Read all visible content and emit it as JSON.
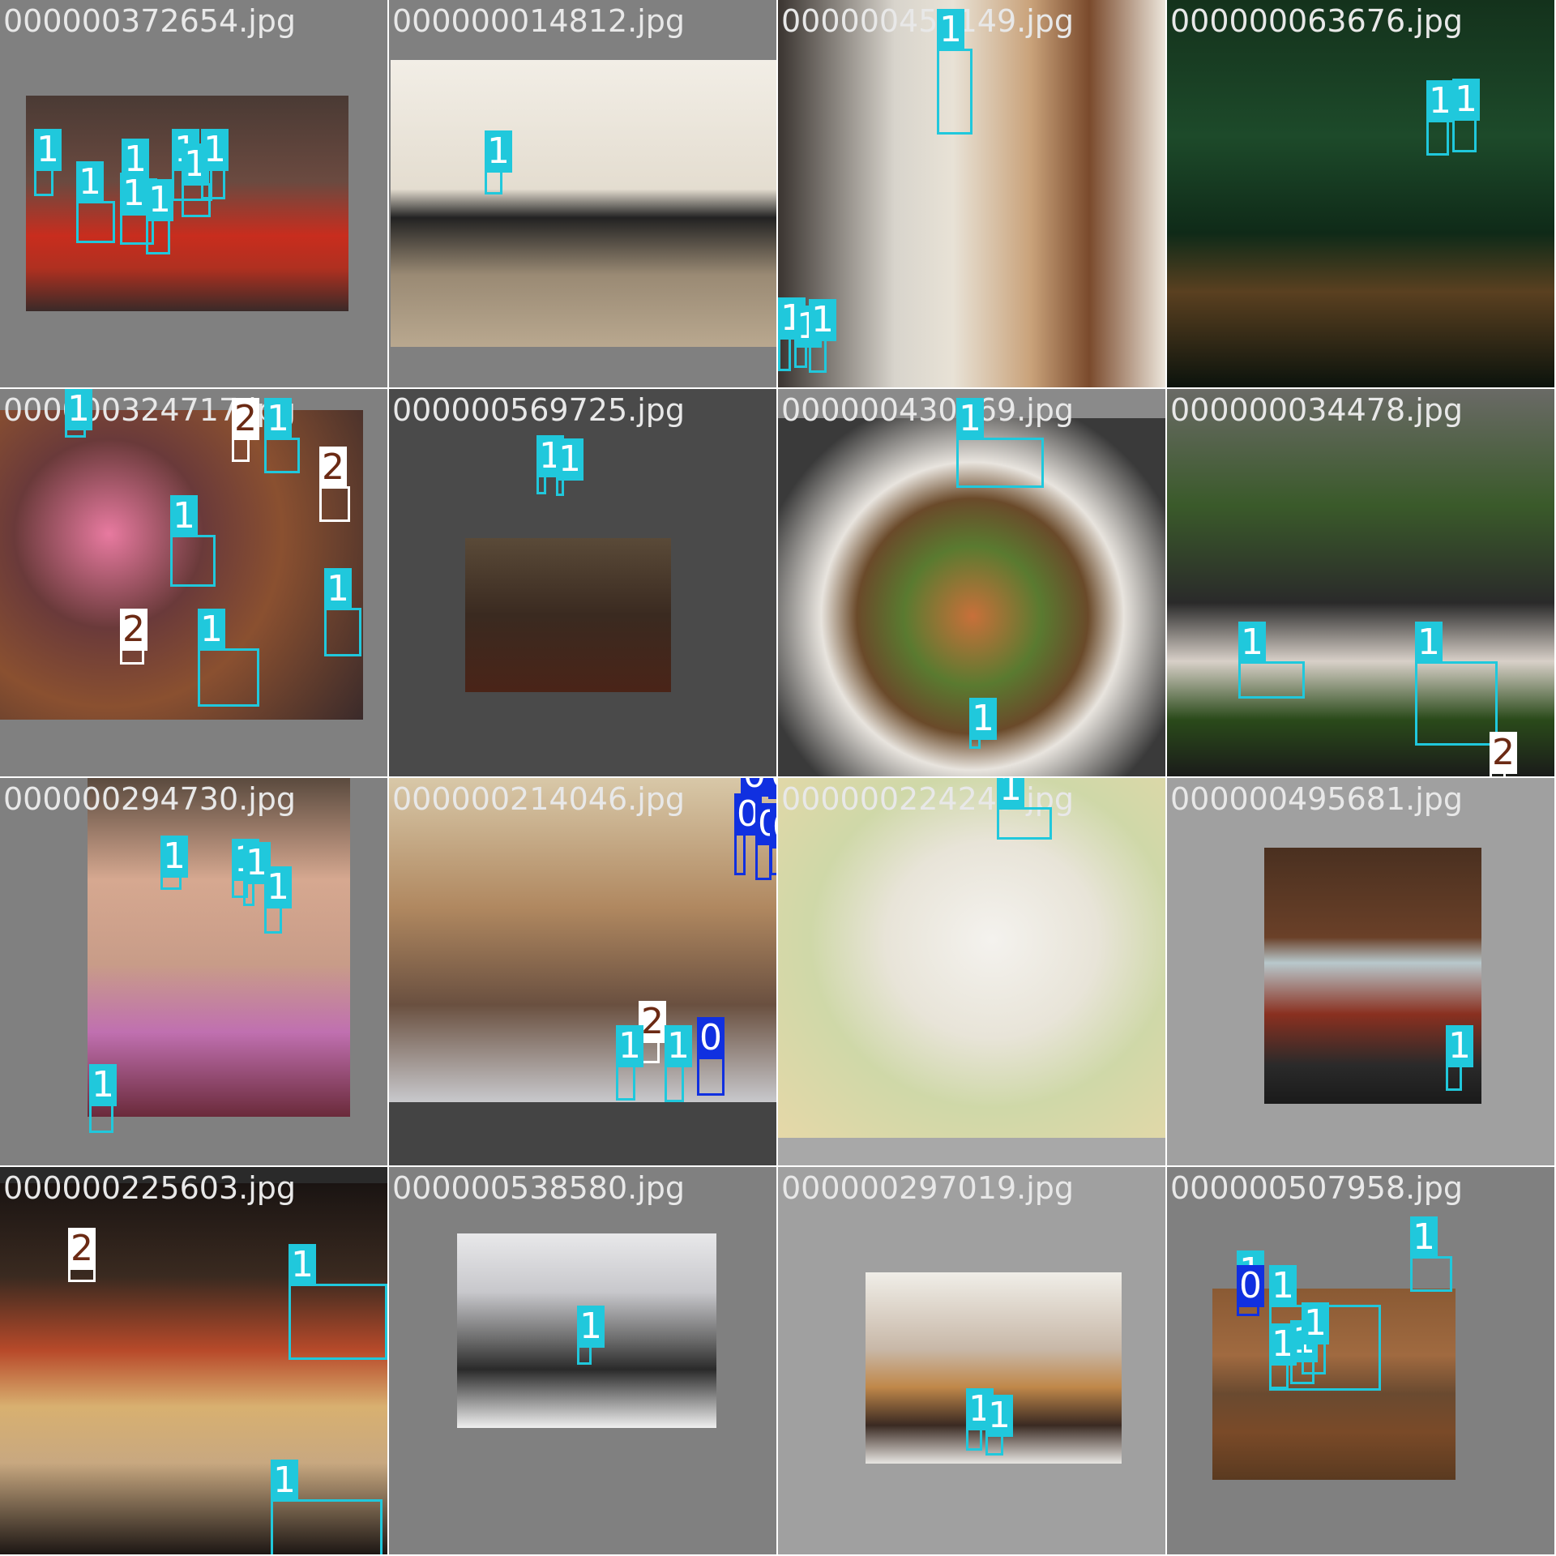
{
  "label_colors": {
    "0": "#1030e0",
    "1": "#20c8dc",
    "2": "#ffffff"
  },
  "tiles": [
    {
      "filename": "000000372654.jpg",
      "bg": "#808080",
      "photo_bg": "linear-gradient(180deg,#4a3a34 0%,#6b4a40 40%,#c82d1e 65%,#b03020 80%,#3a2a28 100%)",
      "boxes": [
        [
          "1"
        ],
        [
          "1"
        ],
        [
          "1"
        ],
        [
          "1"
        ],
        [
          "1"
        ],
        [
          "1"
        ],
        [
          "1"
        ],
        [
          "1"
        ]
      ]
    },
    {
      "filename": "000000014812.jpg",
      "bg": "#808080",
      "photo_bg": "linear-gradient(180deg,#f2eee6 0%,#e4ddd0 45%,#222 55%,#9a8a74 75%,#b9a88f 100%)",
      "boxes": [
        [
          "1"
        ]
      ]
    },
    {
      "filename": "000000455149.jpg",
      "bg": "#6a5a4a",
      "photo_bg": "linear-gradient(90deg,#3a3430 0%,#d8d4cc 30%,#e8e2d6 45%,#c9a27a 65%,#7a4a2c 80%,#efe9df 100%)",
      "boxes": [
        [
          "1"
        ],
        [
          "1"
        ],
        [
          "1"
        ],
        [
          "1"
        ]
      ]
    },
    {
      "filename": "000000063676.jpg",
      "bg": "#101a12",
      "photo_bg": "linear-gradient(180deg,#14321c 0%,#1d4a2a 35%,#0f2a18 60%,#5a4020 75%,#0a120c 100%)",
      "boxes": [
        [
          "1"
        ],
        [
          "1"
        ]
      ]
    },
    {
      "filename": "000000324717.jpg",
      "bg": "#808080",
      "photo_bg": "radial-gradient(circle at 30% 40%,#e87aa0 0%,#6a3a3a 30%,#8a5030 55%,#3a2a2a 100%)",
      "boxes": [
        [
          "1"
        ],
        [
          "2"
        ],
        [
          "1"
        ],
        [
          "2"
        ],
        [
          "1"
        ],
        [
          "1"
        ],
        [
          "1"
        ],
        [
          "2"
        ]
      ]
    },
    {
      "filename": "000000569725.jpg",
      "bg": "#4a4a4a",
      "photo_bg": "linear-gradient(180deg,#5a4a38 0%,#3a2a20 50%,#4a2418 100%)",
      "boxes": [
        [
          "1"
        ],
        [
          "1"
        ]
      ]
    },
    {
      "filename": "000000430469.jpg",
      "bg": "#8a8a8a",
      "photo_bg": "radial-gradient(ellipse at 50% 55%,#c8703a 0%,#5a7a30 25%,#6a4a2a 42%,#e8e4de 55%,#3a3a3a 80%)",
      "boxes": [
        [
          "1"
        ],
        [
          "1"
        ]
      ]
    },
    {
      "filename": "000000034478.jpg",
      "bg": "#3a3a3a",
      "photo_bg": "linear-gradient(180deg,#6a6a66 0%,#3a5a2a 30%,#2a2a2a 55%,#d8d0c8 70%,#2a4a1a 85%,#1a1a1a 100%)",
      "boxes": [
        [
          "1"
        ],
        [
          "1"
        ],
        [
          "2"
        ]
      ]
    },
    {
      "filename": "000000294730.jpg",
      "bg": "#808080",
      "photo_bg": "linear-gradient(180deg,#5a4a3e 0%,#d6a890 30%,#c89c88 55%,#c070b0 75%,#6a2a3a 100%)",
      "boxes": [
        [
          "1"
        ],
        [
          "1"
        ],
        [
          "1"
        ],
        [
          "1"
        ],
        [
          "1"
        ]
      ]
    },
    {
      "filename": "000000214046.jpg",
      "bg": "#444444",
      "photo_bg": "linear-gradient(180deg,#d8c8a8 0%,#b08860 40%,#6a5040 70%,#c8c8cc 100%)",
      "boxes": [
        [
          "0"
        ],
        [
          "0"
        ],
        [
          "0"
        ],
        [
          "0"
        ],
        [
          "0"
        ],
        [
          "0"
        ],
        [
          "2"
        ],
        [
          "1"
        ],
        [
          "1"
        ],
        [
          "0"
        ]
      ]
    },
    {
      "filename": "000000224243.jpg",
      "bg": "#a8a8a8",
      "photo_bg": "radial-gradient(ellipse at 55% 45%,#f4f2ee 0%,#e8e4d8 35%,#cfd8a8 60%,#e6d8a8 100%)",
      "boxes": [
        [
          "1"
        ]
      ]
    },
    {
      "filename": "000000495681.jpg",
      "bg": "#a0a0a0",
      "photo_bg": "linear-gradient(180deg,#4a3020 0%,#6a4028 35%,#b8c8cc 45%,#8a3020 65%,#2a2a2a 85%,#1a1a1a 100%)",
      "boxes": [
        [
          "1"
        ]
      ]
    },
    {
      "filename": "000000225603.jpg",
      "bg": "#2a2a2a",
      "photo_bg": "linear-gradient(180deg,#1a1412 0%,#3a2a20 25%,#b84a2a 45%,#d8b070 60%,#c8a880 75%,#1a1412 100%)",
      "boxes": [
        [
          "2"
        ],
        [
          "1"
        ],
        [
          "1"
        ]
      ]
    },
    {
      "filename": "000000538580.jpg",
      "bg": "#808080",
      "photo_bg": "linear-gradient(180deg,#e8e8ea 0%,#c8c8cc 30%,#6a6a6a 55%,#2a2a2a 70%,#f0f0f0 100%)",
      "boxes": [
        [
          "1"
        ]
      ]
    },
    {
      "filename": "000000297019.jpg",
      "bg": "#a0a0a0",
      "photo_bg": "linear-gradient(180deg,#f0eee8 0%,#c8b8a8 40%,#c0884a 60%,#3a2a22 80%,#e8e6e2 100%)",
      "boxes": [
        [
          "1"
        ],
        [
          "1"
        ]
      ]
    },
    {
      "filename": "000000507958.jpg",
      "bg": "#808080",
      "photo_bg": "linear-gradient(180deg,#8a5a34 0%,#a06a40 35%,#6a4a30 55%,#7a4a28 75%,#5a3a20 100%)",
      "boxes": [
        [
          "1"
        ],
        [
          "0"
        ],
        [
          "1"
        ],
        [
          "1"
        ],
        [
          "1"
        ],
        [
          "1"
        ],
        [
          "1"
        ]
      ]
    }
  ]
}
